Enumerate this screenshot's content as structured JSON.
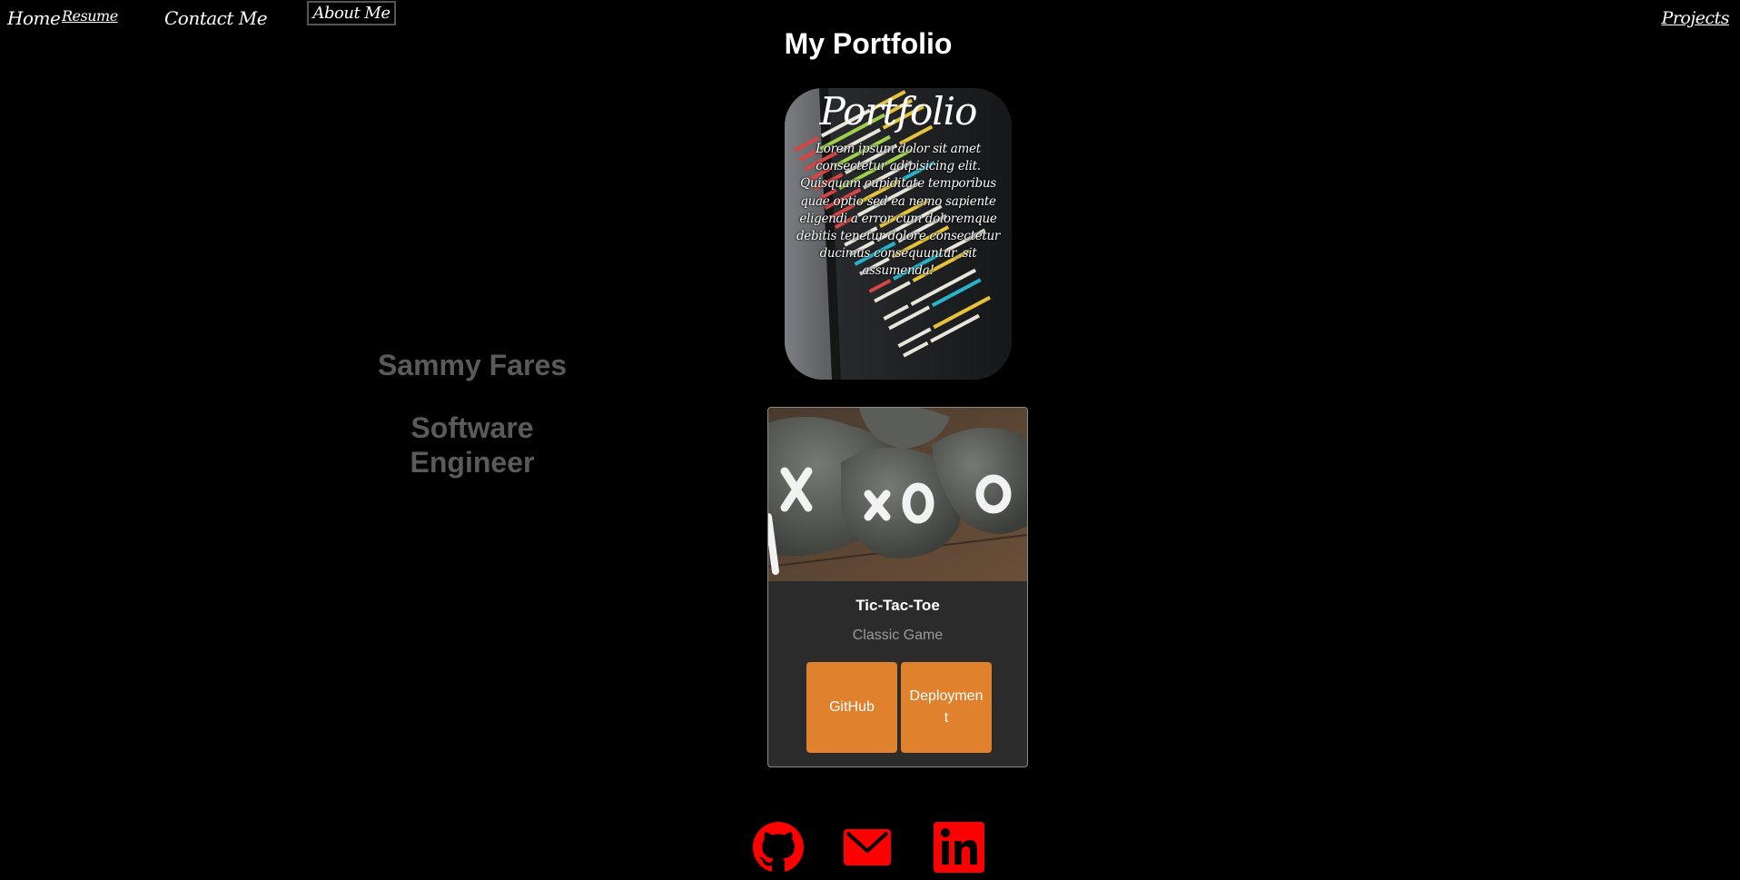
{
  "nav": {
    "home": "Home",
    "resume": "Resume",
    "contact": "Contact Me",
    "about": "About Me",
    "projects": "Projects"
  },
  "page": {
    "title": "My Portfolio"
  },
  "bio": {
    "name": "Sammy Fares",
    "role": "Software Engineer"
  },
  "hero": {
    "title": "Portfolio",
    "text": "Lorem ipsum dolor sit amet consectetur adipisicing elit. Quisquam cupiditate temporibus quae optio sed ea nemo sapiente eligendi a error cum doloremque debitis tenetur dolore consectetur ducimus consequuntur, sit assumenda!"
  },
  "project": {
    "title": "Tic-Tac-Toe",
    "subtitle": "Classic Game",
    "github_label": "GitHub",
    "deployment_label": "Deployment"
  },
  "social": {
    "icons": [
      "github-icon",
      "email-icon",
      "linkedin-icon"
    ],
    "color": "#ff0000"
  },
  "colors": {
    "background": "#000000",
    "button": "#e0812e",
    "card": "#2b2b2b",
    "bio_text": "#5a5a5a"
  }
}
